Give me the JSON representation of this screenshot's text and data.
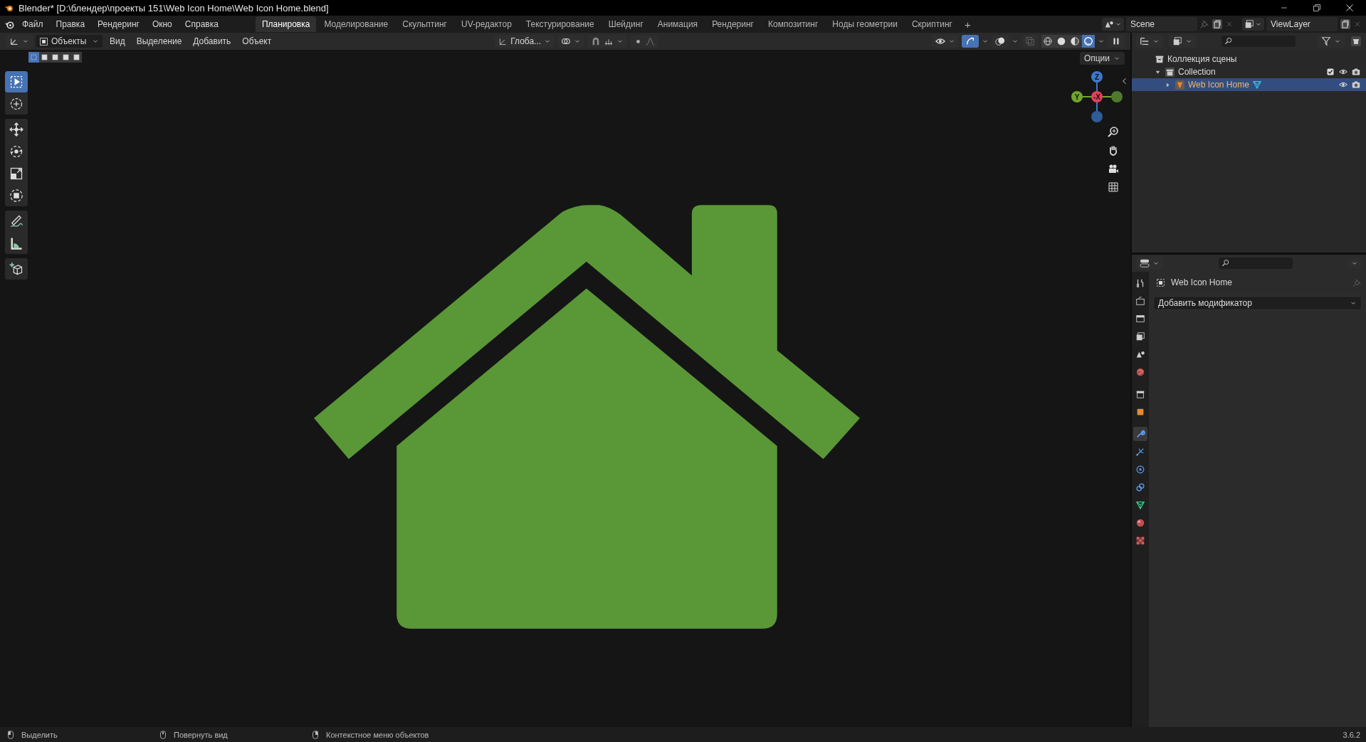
{
  "title_bar": {
    "title": "Blender* [D:\\блендер\\проекты 151\\Web Icon Home\\Web Icon Home.blend]"
  },
  "menu": [
    "Файл",
    "Правка",
    "Рендеринг",
    "Окно",
    "Справка"
  ],
  "workspaces": [
    {
      "label": "Планировка",
      "selected": true
    },
    {
      "label": "Моделирование",
      "selected": false
    },
    {
      "label": "Скульптинг",
      "selected": false
    },
    {
      "label": "UV-редактор",
      "selected": false
    },
    {
      "label": "Текстурирование",
      "selected": false
    },
    {
      "label": "Шейдинг",
      "selected": false
    },
    {
      "label": "Анимация",
      "selected": false
    },
    {
      "label": "Рендеринг",
      "selected": false
    },
    {
      "label": "Композитинг",
      "selected": false
    },
    {
      "label": "Ноды геометрии",
      "selected": false
    },
    {
      "label": "Скриптинг",
      "selected": false
    }
  ],
  "add_workspace": "+",
  "scene": "Scene",
  "view_layer": "ViewLayer",
  "viewport": {
    "mode": "Объекты",
    "menus": [
      "Вид",
      "Выделение",
      "Добавить",
      "Объект"
    ],
    "orientation": "Глоба...",
    "options": "Опции",
    "select_modes": [
      {
        "selected": true
      },
      {
        "selected": false
      },
      {
        "selected": false
      },
      {
        "selected": false
      },
      {
        "selected": false
      }
    ],
    "shading": [
      {
        "kind": "wireframe",
        "selected": false
      },
      {
        "kind": "solid",
        "selected": false
      },
      {
        "kind": "material",
        "selected": false
      },
      {
        "kind": "rendered",
        "selected": true
      }
    ],
    "tools": [
      {
        "kind": "select",
        "selected": true
      },
      {
        "kind": "cursor",
        "selected": false
      },
      {
        "kind": "move",
        "selected": false
      },
      {
        "kind": "rotate",
        "selected": false
      },
      {
        "kind": "scale",
        "selected": false
      },
      {
        "kind": "transform",
        "selected": false
      },
      {
        "kind": "annotate",
        "selected": false
      },
      {
        "kind": "measure",
        "selected": false
      },
      {
        "kind": "add_cube",
        "selected": false
      }
    ],
    "toggles": [
      {
        "kind": "gizmos",
        "on": true
      },
      {
        "kind": "overlays",
        "on": false
      },
      {
        "kind": "xray",
        "on": false
      }
    ],
    "gizmo": [
      {
        "kind": "z",
        "label": "Z"
      },
      {
        "kind": "y",
        "label": "Y"
      },
      {
        "kind": "x",
        "label": "-X"
      }
    ]
  },
  "outliner": {
    "tree": [
      {
        "label": "Коллекция сцены",
        "kind": "scene_collection",
        "selected": false,
        "children": [
          {
            "label": "Collection",
            "kind": "collection",
            "selected": false,
            "expanded": true,
            "checked": true,
            "children": [
              {
                "label": "Web Icon Home",
                "kind": "object",
                "selected": true,
                "expanded": false
              }
            ]
          }
        ]
      }
    ]
  },
  "properties": {
    "tabs": [
      {
        "kind": "tool",
        "selected": false
      },
      {
        "kind": "render",
        "selected": false
      },
      {
        "kind": "output",
        "selected": false
      },
      {
        "kind": "view_layer",
        "selected": false
      },
      {
        "kind": "scene",
        "selected": false
      },
      {
        "kind": "world",
        "selected": false
      },
      {
        "kind": "collection",
        "selected": false
      },
      {
        "kind": "object",
        "selected": false
      },
      {
        "kind": "modifiers",
        "selected": true
      },
      {
        "kind": "particles",
        "selected": false
      },
      {
        "kind": "physics",
        "selected": false
      },
      {
        "kind": "constraints",
        "selected": false
      },
      {
        "kind": "data",
        "selected": false
      },
      {
        "kind": "material",
        "selected": false
      },
      {
        "kind": "texture",
        "selected": false
      }
    ],
    "object_name": "Web Icon Home",
    "add_modifier": "Добавить модификатор"
  },
  "status_bar": {
    "items": [
      {
        "label": "Выделить",
        "kind": "left"
      },
      {
        "label": "Повернуть вид",
        "kind": "middle"
      },
      {
        "label": "Контекстное меню объектов",
        "kind": "right"
      }
    ],
    "version": "3.6.2"
  }
}
